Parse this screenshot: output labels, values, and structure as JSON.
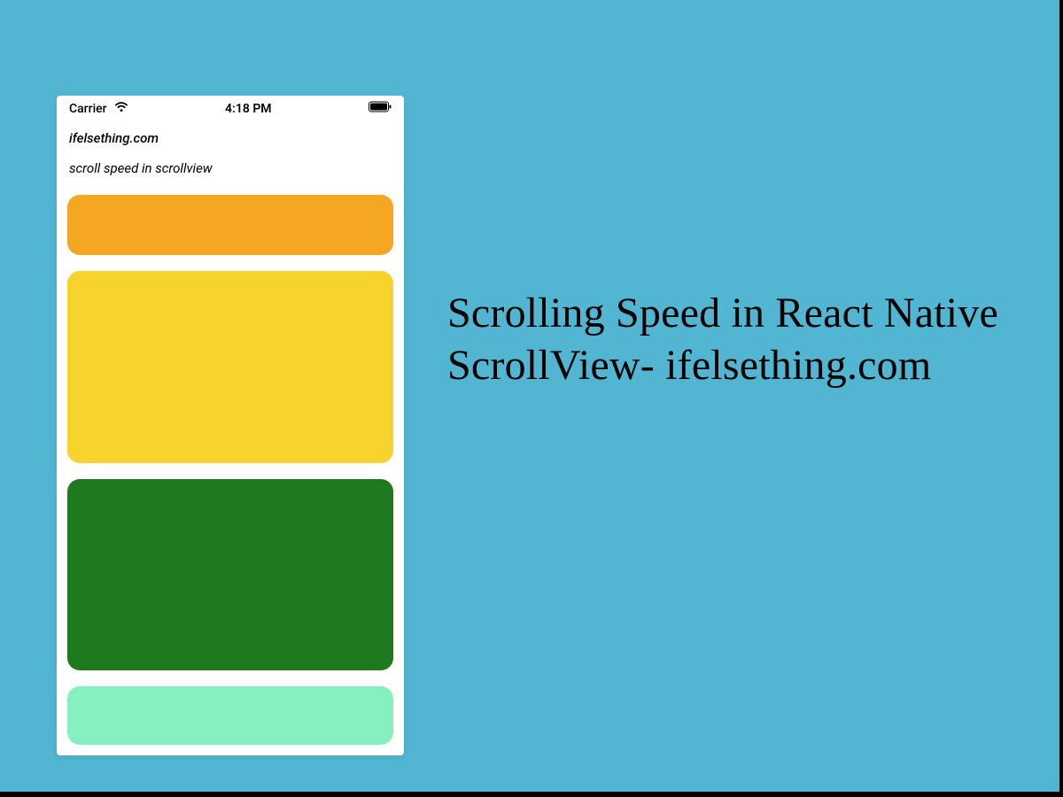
{
  "statusBar": {
    "carrier": "Carrier",
    "time": "4:18 PM"
  },
  "header": {
    "title": "ifelsething.com",
    "subtitle": "scroll speed in scrollview"
  },
  "cards": [
    {
      "name": "card-orange",
      "color": "#f5a623"
    },
    {
      "name": "card-yellow",
      "color": "#f6d32d"
    },
    {
      "name": "card-green",
      "color": "#1f7a1f"
    },
    {
      "name": "card-mint",
      "color": "#87f0c0"
    }
  ],
  "mainTitle": "Scrolling Speed in React Native ScrollView- ifelsething.com"
}
